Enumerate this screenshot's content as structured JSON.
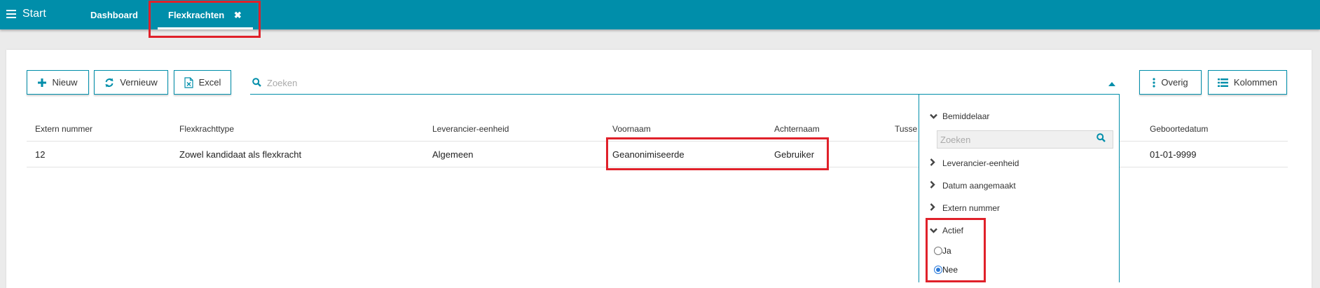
{
  "topbar": {
    "start_label": "Start",
    "tabs": [
      {
        "label": "Dashboard"
      },
      {
        "label": "Flexkrachten",
        "close": "✖"
      }
    ]
  },
  "toolbar": {
    "new_label": "Nieuw",
    "refresh_label": "Vernieuw",
    "excel_label": "Excel",
    "more_label": "Overig",
    "columns_label": "Kolommen"
  },
  "search": {
    "placeholder": "Zoeken",
    "value": ""
  },
  "table": {
    "headers": [
      "Extern nummer",
      "Flexkrachttype",
      "Leverancier-eenheid",
      "Voornaam",
      "Achternaam",
      "Tusse",
      "Geboortedatum"
    ],
    "rows": [
      [
        "12",
        "Zowel kandidaat als flexkracht",
        "Algemeen",
        "Geanonimiseerde",
        "Gebruiker",
        "",
        "01-01-9999"
      ]
    ]
  },
  "filter_panel": {
    "sections": [
      {
        "label": "Bemiddelaar",
        "expanded": true
      },
      {
        "label": "Leverancier-eenheid",
        "expanded": false
      },
      {
        "label": "Datum aangemaakt",
        "expanded": false
      },
      {
        "label": "Extern nummer",
        "expanded": false
      },
      {
        "label": "Actief",
        "expanded": true
      }
    ],
    "search_placeholder": "Zoeken",
    "actief_options": [
      {
        "label": "Ja",
        "selected": false
      },
      {
        "label": "Nee",
        "selected": true
      }
    ]
  },
  "colors": {
    "accent": "#008eaa",
    "highlight": "#e0212a",
    "radio": "#2b7ad9"
  },
  "icons": [
    "menu-icon",
    "close-icon",
    "plus-icon",
    "refresh-icon",
    "excel-icon",
    "search-icon",
    "caret-up-icon",
    "more-vertical-icon",
    "list-icon",
    "chevron-down-icon",
    "chevron-right-icon"
  ]
}
